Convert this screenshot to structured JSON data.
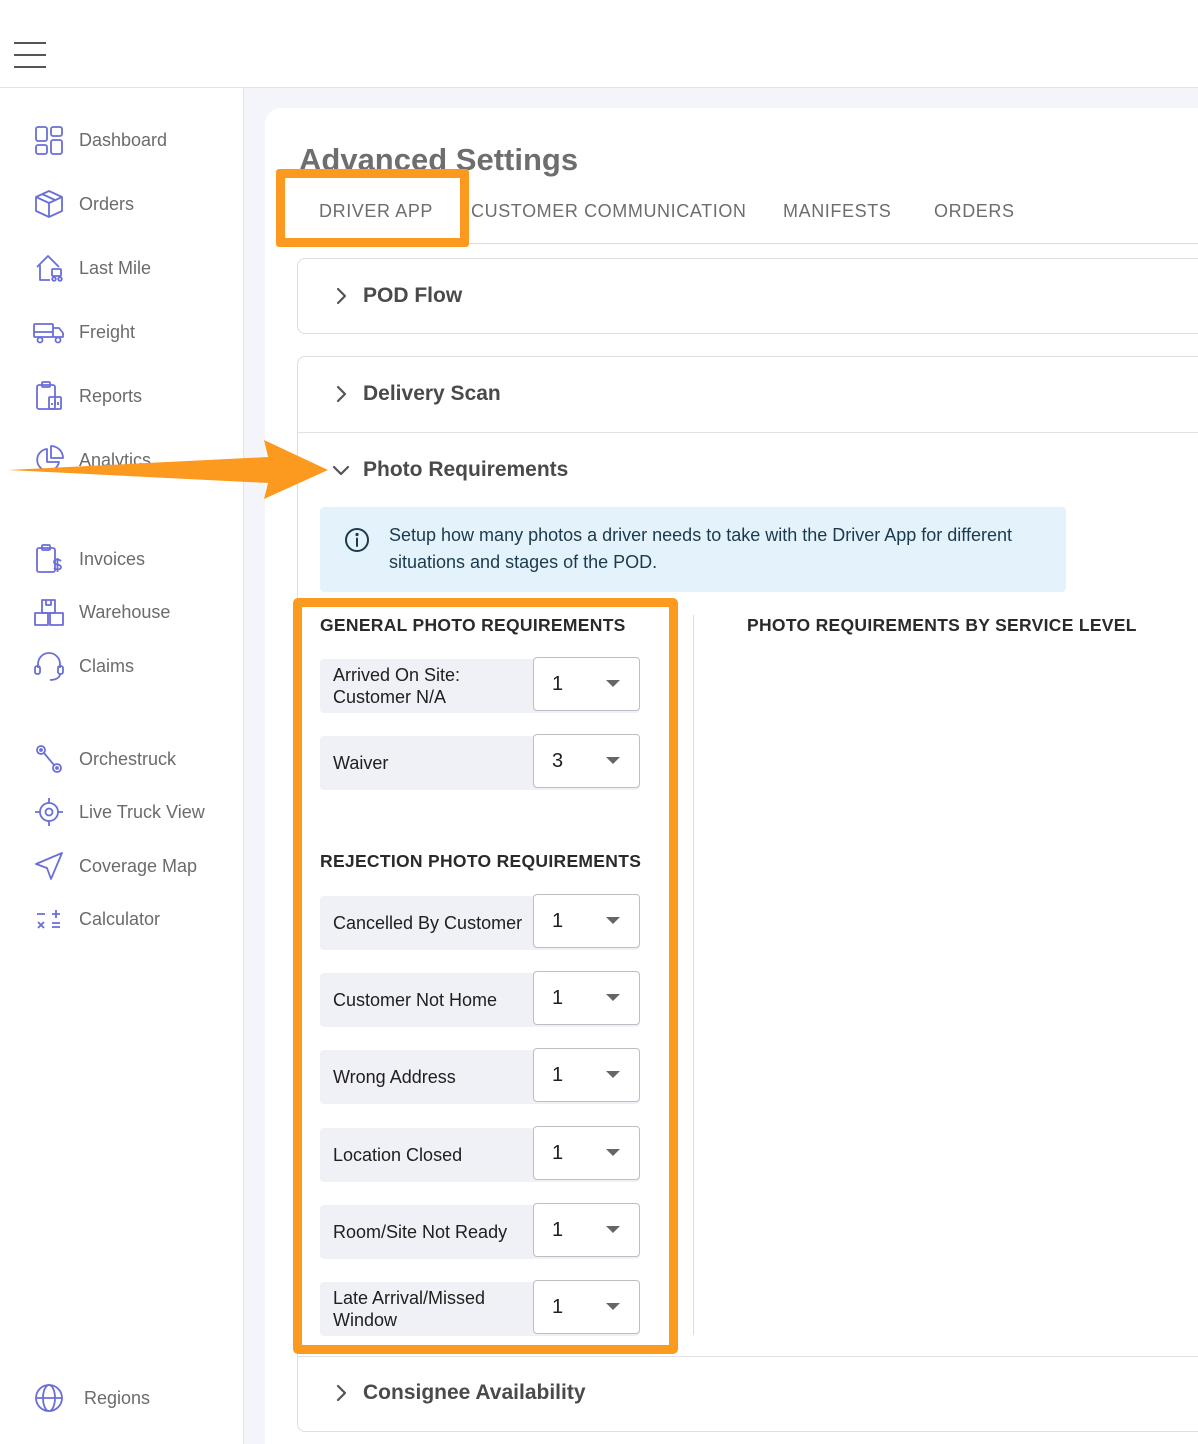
{
  "topbar": {
    "menu_icon": "hamburger-menu-icon"
  },
  "sidebar": {
    "items": [
      {
        "label": "Dashboard",
        "icon": "dashboard-icon"
      },
      {
        "label": "Orders",
        "icon": "box-icon"
      },
      {
        "label": "Last Mile",
        "icon": "last-mile-icon"
      },
      {
        "label": "Freight",
        "icon": "truck-icon"
      },
      {
        "label": "Reports",
        "icon": "reports-icon"
      },
      {
        "label": "Analytics",
        "icon": "pie-chart-icon"
      },
      {
        "label": "Invoices",
        "icon": "invoice-icon"
      },
      {
        "label": "Warehouse",
        "icon": "warehouse-icon"
      },
      {
        "label": "Claims",
        "icon": "headset-icon"
      },
      {
        "label": "Orchestruck",
        "icon": "route-icon"
      },
      {
        "label": "Live Truck View",
        "icon": "crosshair-icon"
      },
      {
        "label": "Coverage Map",
        "icon": "navigation-icon"
      },
      {
        "label": "Calculator",
        "icon": "calculator-icon"
      },
      {
        "label": "Regions",
        "icon": "globe-icon"
      }
    ]
  },
  "page": {
    "title": "Advanced Settings"
  },
  "tabs": [
    {
      "label": "DRIVER APP",
      "active": true
    },
    {
      "label": "CUSTOMER COMMUNICATION",
      "active": false
    },
    {
      "label": "MANIFESTS",
      "active": false
    },
    {
      "label": "ORDERS",
      "active": false
    }
  ],
  "accordions": {
    "pod_flow": {
      "title": "POD Flow",
      "expanded": false
    },
    "delivery_scan": {
      "title": "Delivery Scan",
      "expanded": false
    },
    "photo_requirements": {
      "title": "Photo Requirements",
      "expanded": true
    },
    "consignee_availability": {
      "title": "Consignee Availability",
      "expanded": false
    }
  },
  "photo_requirements": {
    "info_text": "Setup how many photos a driver needs to take with the Driver App for different situations and stages of the POD.",
    "general_title": "GENERAL PHOTO REQUIREMENTS",
    "general": [
      {
        "label": "Arrived On Site: Customer N/A",
        "value": "1"
      },
      {
        "label": "Waiver",
        "value": "3"
      }
    ],
    "rejection_title": "REJECTION PHOTO REQUIREMENTS",
    "rejection": [
      {
        "label": "Cancelled By Customer",
        "value": "1"
      },
      {
        "label": "Customer Not Home",
        "value": "1"
      },
      {
        "label": "Wrong Address",
        "value": "1"
      },
      {
        "label": "Location Closed",
        "value": "1"
      },
      {
        "label": "Room/Site Not Ready",
        "value": "1"
      },
      {
        "label": "Late Arrival/Missed Window",
        "value": "1"
      }
    ],
    "service_level_title": "PHOTO REQUIREMENTS BY SERVICE LEVEL"
  },
  "colors": {
    "highlight": "#fb9a1e",
    "nav_icon": "#6a6fd8",
    "info_background": "#e4f3fb",
    "content_background": "#f4f5fb"
  }
}
